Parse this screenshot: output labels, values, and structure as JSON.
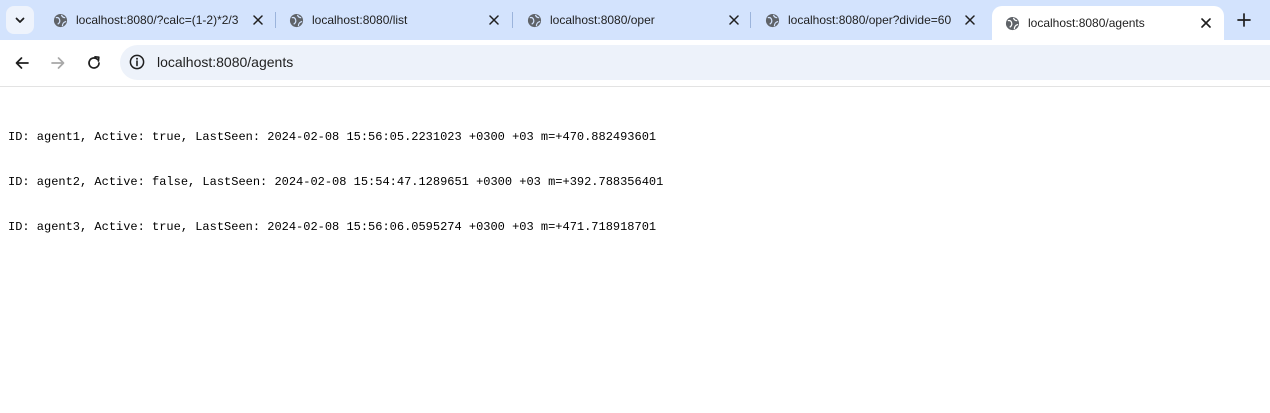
{
  "tabs": [
    {
      "title": "localhost:8080/?calc=(1-2)*2/3",
      "icon": "globe-icon",
      "active": false
    },
    {
      "title": "localhost:8080/list",
      "icon": "globe-icon",
      "active": false
    },
    {
      "title": "localhost:8080/oper",
      "icon": "globe-icon",
      "active": false
    },
    {
      "title": "localhost:8080/oper?divide=60",
      "icon": "globe-icon",
      "active": false
    },
    {
      "title": "localhost:8080/agents",
      "icon": "globe-icon",
      "active": true
    }
  ],
  "toolbar": {
    "url": "localhost:8080/agents"
  },
  "content": {
    "lines": [
      "ID: agent1, Active: true, LastSeen: 2024-02-08 15:56:05.2231023 +0300 +03 m=+470.882493601",
      "ID: agent2, Active: false, LastSeen: 2024-02-08 15:54:47.1289651 +0300 +03 m=+392.788356401",
      "ID: agent3, Active: true, LastSeen: 2024-02-08 15:56:06.0595274 +0300 +03 m=+471.718918701"
    ]
  },
  "colors": {
    "tabstrip": "#d3e3fd",
    "omnibox": "#edf2fa",
    "active_tab": "#ffffff"
  }
}
